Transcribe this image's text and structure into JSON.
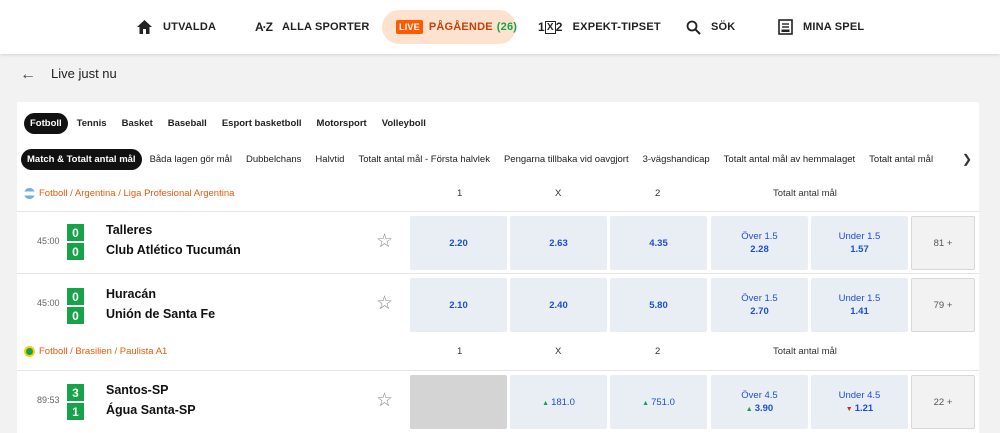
{
  "nav": [
    {
      "label": "UTVALDA",
      "icon": "home-icon"
    },
    {
      "label": "ALLA SPORTER",
      "icon": "az-icon"
    },
    {
      "label": "PÅGÅENDE",
      "badge": "LIVE",
      "count": "(26)",
      "icon": "live-badge"
    },
    {
      "label": "EXPEKT-TIPSET",
      "icon": "1x2-icon"
    },
    {
      "label": "SÖK",
      "icon": "search-icon"
    },
    {
      "label": "MINA SPEL",
      "icon": "betslip-icon"
    }
  ],
  "page": {
    "back_icon": "←",
    "title": "Live just nu"
  },
  "sport_tabs": [
    "Fotboll",
    "Tennis",
    "Basket",
    "Baseball",
    "Esport basketboll",
    "Motorsport",
    "Volleyboll"
  ],
  "market_tabs": [
    "Match & Totalt antal mål",
    "Båda lagen gör mål",
    "Dubbelchans",
    "Halvtid",
    "Totalt antal mål - Första halvlek",
    "Pengarna tillbaka vid oavgjort",
    "3-vägshandicap",
    "Totalt antal mål av hemmalaget",
    "Totalt antal mål"
  ],
  "col_headers": {
    "c1": "1",
    "cx": "X",
    "c2": "2",
    "total": "Totalt antal mål"
  },
  "leagues": [
    {
      "name": "Fotboll / Argentina / Liga Profesional Argentina",
      "flag_color": "#74acdf"
    },
    {
      "name": "Fotboll / Brasilien / Paulista A1",
      "flag_color": "#16a34a"
    }
  ],
  "matches": [
    {
      "time": "45:00",
      "home": "Talleres",
      "away": "Club Atlético Tucumán",
      "home_score": "0",
      "away_score": "0",
      "o1": "2.20",
      "ox": "2.63",
      "o2": "4.35",
      "over_label": "Över 1.5",
      "over": "2.28",
      "under_label": "Under 1.5",
      "under": "1.57",
      "more": "81 +"
    },
    {
      "time": "45:00",
      "home": "Huracán",
      "away": "Unión de Santa Fe",
      "home_score": "0",
      "away_score": "0",
      "o1": "2.10",
      "ox": "2.40",
      "o2": "5.80",
      "over_label": "Över 1.5",
      "over": "2.70",
      "under_label": "Under 1.5",
      "under": "1.41",
      "more": "79 +"
    },
    {
      "time": "89:53",
      "home": "Santos-SP",
      "away": "Água Santa-SP",
      "home_score": "3",
      "away_score": "1",
      "o1": "",
      "ox": "181.0",
      "o2": "751.0",
      "over_label": "Över 4.5",
      "over": "3.90",
      "under_label": "Under 4.5",
      "under": "1.21",
      "more": "22 +"
    }
  ]
}
